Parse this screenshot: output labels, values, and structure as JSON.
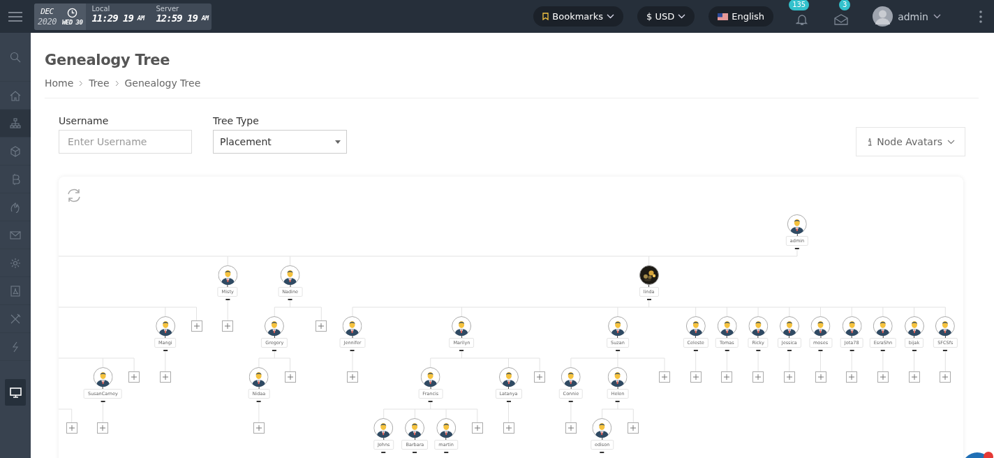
{
  "header": {
    "date_widget": {
      "month": "DEC",
      "year": "2020",
      "day": "WED 30",
      "local_label": "Local",
      "local_time": "11:29 19",
      "local_period": "AM",
      "server_label": "Server",
      "server_time": "12:59 19",
      "server_period": "AM"
    },
    "bookmarks": "Bookmarks",
    "currency": "$ USD",
    "language": "English",
    "notifications": "135",
    "messages": "3",
    "user": "admin"
  },
  "sidebar": {
    "items": [
      {
        "kind": "nav",
        "selected": false
      },
      {
        "kind": "nav",
        "selected": false
      },
      {
        "kind": "nav",
        "selected": true
      },
      {
        "kind": "nav",
        "selected": false
      },
      {
        "kind": "nav",
        "selected": false
      },
      {
        "kind": "nav",
        "selected": false
      },
      {
        "kind": "nav",
        "selected": false
      },
      {
        "kind": "nav",
        "selected": false
      },
      {
        "kind": "nav",
        "selected": false
      },
      {
        "kind": "nav",
        "selected": false
      },
      {
        "kind": "nav",
        "selected": false
      },
      {
        "kind": "toggle",
        "selected": true
      }
    ]
  },
  "page": {
    "title": "Genealogy Tree",
    "breadcrumb": [
      "Home",
      "Tree",
      "Genealogy Tree"
    ]
  },
  "filters": {
    "username": {
      "label": "Username",
      "placeholder": "Enter Username"
    },
    "tree_type": {
      "label": "Tree Type",
      "value": "Placement"
    },
    "node_avatars": "Node Avatars"
  },
  "tree": {
    "kind": "member",
    "username": "admin",
    "photo": false,
    "children": [
      {
        "kind": "hidden",
        "children": [
          {
            "kind": "hidden",
            "children": [
              {
                "kind": "hidden",
                "children": [
                  {
                    "kind": "hidden"
                  },
                  {
                    "kind": "add"
                  }
                ]
              },
              {
                "kind": "member",
                "username": "SusanCarney",
                "photo": false,
                "children": [
                  {
                    "kind": "add"
                  }
                ]
              },
              {
                "kind": "add"
              }
            ]
          },
          {
            "kind": "member",
            "username": "Mangi",
            "photo": false,
            "children": [
              {
                "kind": "add"
              }
            ]
          },
          {
            "kind": "add"
          }
        ]
      },
      {
        "kind": "member",
        "username": "Misty",
        "photo": false,
        "children": [
          {
            "kind": "add"
          }
        ]
      },
      {
        "kind": "member",
        "username": "Nadine",
        "photo": false,
        "children": [
          {
            "kind": "member",
            "username": "Gregory",
            "photo": false,
            "children": [
              {
                "kind": "member",
                "username": "Nidaa",
                "photo": false,
                "children": [
                  {
                    "kind": "add"
                  }
                ]
              },
              {
                "kind": "add"
              }
            ]
          },
          {
            "kind": "add"
          }
        ]
      },
      {
        "kind": "member",
        "username": "linda",
        "photo": true,
        "children": [
          {
            "kind": "member",
            "username": "Jennifer",
            "photo": false,
            "children": [
              {
                "kind": "add"
              }
            ]
          },
          {
            "kind": "member",
            "username": "Marilyn",
            "photo": false,
            "children": [
              {
                "kind": "member",
                "username": "Francis",
                "photo": false,
                "children": [
                  {
                    "kind": "member",
                    "username": "Johns",
                    "photo": false
                  },
                  {
                    "kind": "member",
                    "username": "Barbara",
                    "photo": false
                  },
                  {
                    "kind": "member",
                    "username": "martin",
                    "photo": false
                  },
                  {
                    "kind": "add"
                  }
                ]
              },
              {
                "kind": "member",
                "username": "Latanya",
                "photo": false,
                "children": [
                  {
                    "kind": "add"
                  }
                ]
              },
              {
                "kind": "add"
              }
            ]
          },
          {
            "kind": "member",
            "username": "Suzan",
            "photo": false,
            "children": [
              {
                "kind": "member",
                "username": "Connie",
                "photo": false,
                "children": [
                  {
                    "kind": "add"
                  }
                ]
              },
              {
                "kind": "member",
                "username": "Helen",
                "photo": false,
                "children": [
                  {
                    "kind": "member",
                    "username": "edison",
                    "photo": false
                  },
                  {
                    "kind": "add"
                  }
                ]
              },
              {
                "kind": "add"
              }
            ]
          },
          {
            "kind": "member",
            "username": "Celeste",
            "photo": false,
            "children": [
              {
                "kind": "add"
              }
            ]
          },
          {
            "kind": "member",
            "username": "Tomas",
            "photo": false,
            "children": [
              {
                "kind": "add"
              }
            ]
          },
          {
            "kind": "member",
            "username": "Ricky",
            "photo": false,
            "children": [
              {
                "kind": "add"
              }
            ]
          },
          {
            "kind": "member",
            "username": "Jessica",
            "photo": false,
            "children": [
              {
                "kind": "add"
              }
            ]
          },
          {
            "kind": "member",
            "username": "moses",
            "photo": false,
            "children": [
              {
                "kind": "add"
              }
            ]
          },
          {
            "kind": "member",
            "username": "Jota78",
            "photo": false,
            "children": [
              {
                "kind": "add"
              }
            ]
          },
          {
            "kind": "member",
            "username": "EsraShn",
            "photo": false,
            "children": [
              {
                "kind": "add"
              }
            ]
          },
          {
            "kind": "member",
            "username": "bijak",
            "photo": false,
            "children": [
              {
                "kind": "add"
              }
            ]
          },
          {
            "kind": "member",
            "username": "SFCSfs",
            "photo": false,
            "children": [
              {
                "kind": "add"
              }
            ]
          }
        ]
      }
    ]
  }
}
